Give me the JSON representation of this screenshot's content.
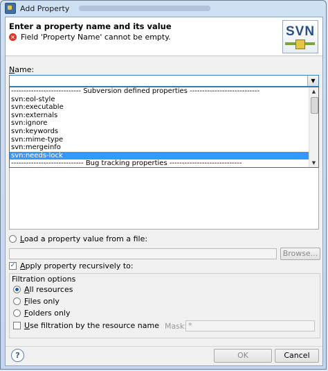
{
  "window": {
    "title": "Add Property",
    "subtitle_blurred": ""
  },
  "header": {
    "title": "Enter a property name and its value",
    "error_message": "Field 'Property Name' cannot be empty.",
    "error_icon": "error-icon",
    "logo_text": "SVN"
  },
  "name": {
    "label_prefix": "N",
    "label_rest": "ame:",
    "value": "",
    "dropdown_items": [
      "---------------------------- Subversion defined properties ----------------------------",
      "svn:eol-style",
      "svn:executable",
      "svn:externals",
      "svn:ignore",
      "svn:keywords",
      "svn:mime-type",
      "svn:mergeinfo",
      "svn:needs-lock",
      "----------------------------- Bug tracking properties -----------------------------"
    ],
    "selected_index": 8
  },
  "load_file": {
    "label_prefix": "L",
    "label_rest": "oad a property value from a file:",
    "checked": false,
    "browse_label": "Browse..."
  },
  "recursive": {
    "label_prefix": "A",
    "label_rest": "pply property recursively to:",
    "checked": true
  },
  "filtration": {
    "title": "Filtration options",
    "options": [
      {
        "prefix": "A",
        "rest": "ll resources",
        "checked": true
      },
      {
        "prefix": "F",
        "rest": "iles only",
        "checked": false
      },
      {
        "prefix": "F",
        "rest": "olders only",
        "checked": false
      }
    ],
    "use_filter_prefix": "U",
    "use_filter_rest": "se filtration by the resource name",
    "use_filter_checked": false,
    "mask_label": "Mask:",
    "mask_value": "*"
  },
  "footer": {
    "help_icon": "help-icon",
    "ok_label": "OK",
    "cancel_label": "Cancel"
  },
  "colors": {
    "selection": "#3399ff",
    "error": "#d9362b",
    "logo": "#2a4f88"
  }
}
